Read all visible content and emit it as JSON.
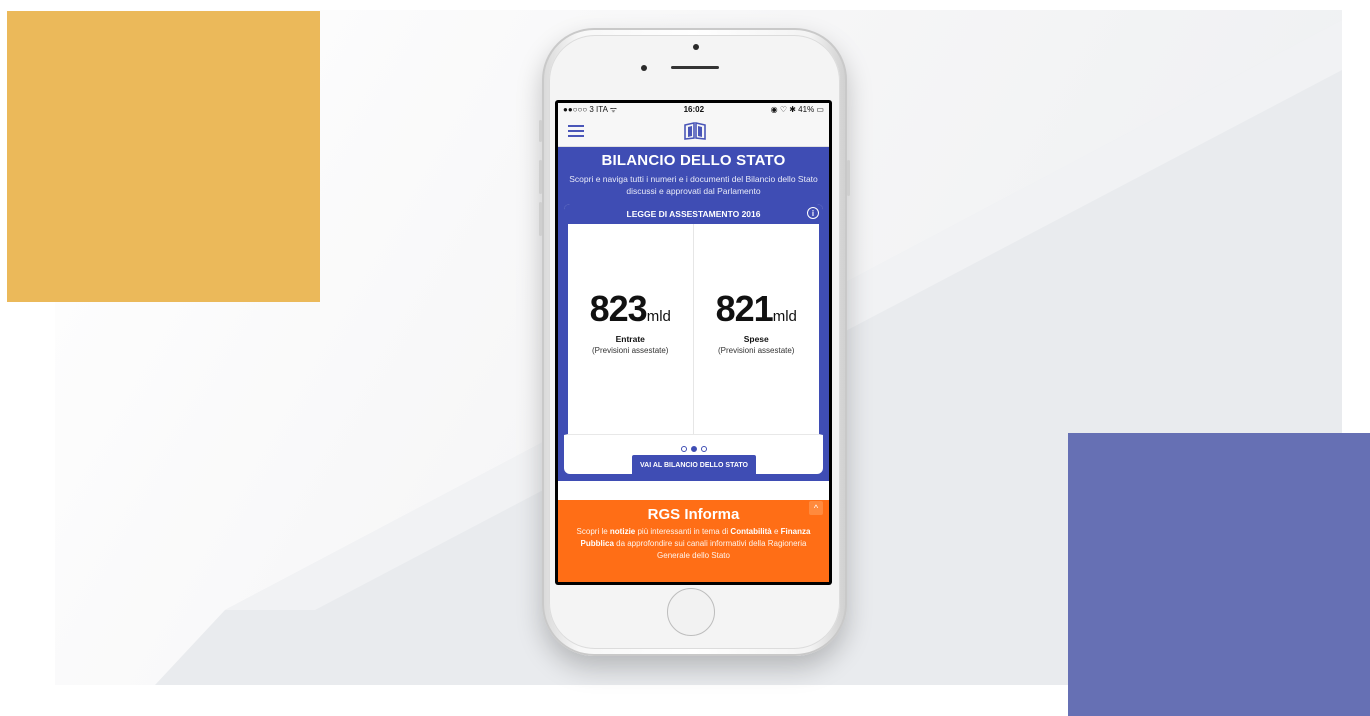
{
  "status_bar": {
    "carrier": "●●○○○ 3 ITA ᯤ",
    "time": "16:02",
    "right": "◉ ♡ ✱ 41% ▭"
  },
  "header": {
    "menu_icon": "hamburger-icon",
    "logo_icon": "book-logo-icon"
  },
  "hero": {
    "title": "BILANCIO DELLO STATO",
    "subtitle": "Scopri e naviga tutti i numeri e i documenti del Bilancio dello Stato discussi e approvati dal Parlamento"
  },
  "card": {
    "heading": "LEGGE DI ASSESTAMENTO 2016",
    "info_icon": "i",
    "stats": [
      {
        "value": "823",
        "unit": "mld",
        "label": "Entrate",
        "note": "(Previsioni assestate)"
      },
      {
        "value": "821",
        "unit": "mld",
        "label": "Spese",
        "note": "(Previsioni assestate)"
      }
    ],
    "carousel": {
      "count": 3,
      "active": 2
    },
    "cta_label": "VAI AL BILANCIO DELLO STATO"
  },
  "rgs": {
    "title": "RGS Informa",
    "text_parts": [
      "Scopri le ",
      "notizie",
      " più interessanti in tema di ",
      "Contabilità",
      " e ",
      "Finanza Pubblica",
      " da approfondire sui canali informativi della Ragioneria Generale dello Stato"
    ],
    "toggle": "^"
  },
  "colors": {
    "primary_blue": "#3f4db4",
    "orange": "#ff6e16",
    "deco_yellow": "#ebb95a",
    "deco_blue": "#6670b4"
  }
}
